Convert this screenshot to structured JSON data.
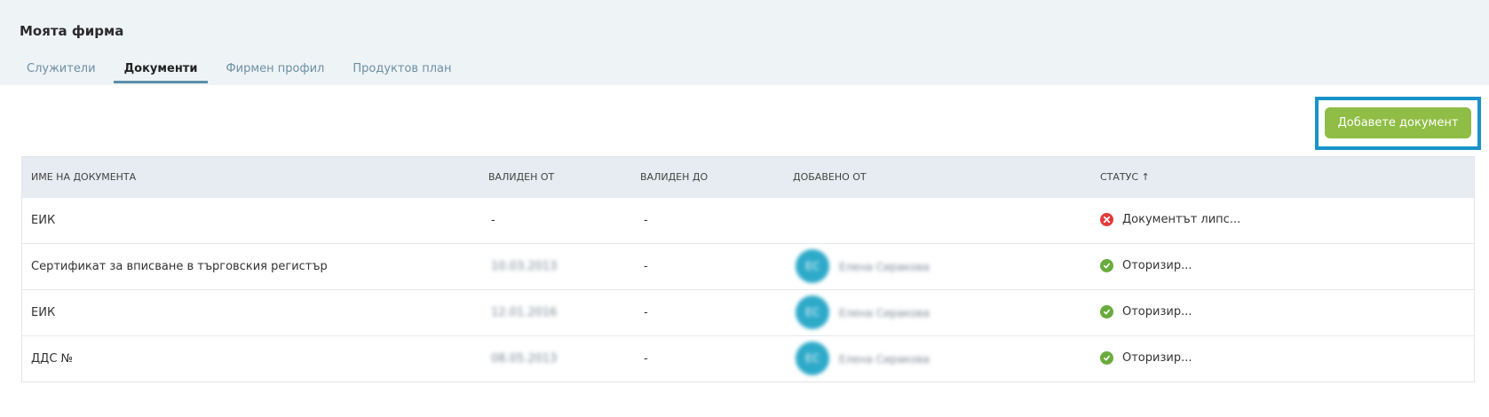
{
  "header": {
    "title": "Моята фирма",
    "tabs": [
      {
        "label": "Служители"
      },
      {
        "label": "Документи"
      },
      {
        "label": "Фирмен профил"
      },
      {
        "label": "Продуктов план"
      }
    ]
  },
  "actions": {
    "add_document_label": "Добавете документ"
  },
  "table": {
    "columns": {
      "name": "ИМЕ НА ДОКУМЕНТА",
      "valid_from": "ВАЛИДЕН ОТ",
      "valid_to": "ВАЛИДЕН ДО",
      "added_by": "ДОБАВЕНО ОТ",
      "status": "СТАТУС",
      "status_sort_icon": "↑"
    },
    "rows": [
      {
        "name": "ЕИК",
        "valid_from": "-",
        "valid_to": "-",
        "added_by_initials": "",
        "added_by": "",
        "status": "Документът липс...",
        "status_type": "missing"
      },
      {
        "name": "Сертификат за вписване в търговския регистър",
        "valid_from": "10.03.2013",
        "valid_to": "-",
        "added_by_initials": "ЕС",
        "added_by": "Елена Сиракова",
        "status": "Оторизир...",
        "status_type": "ok"
      },
      {
        "name": "ЕИК",
        "valid_from": "12.01.2016",
        "valid_to": "-",
        "added_by_initials": "ЕС",
        "added_by": "Елена Сиракова",
        "status": "Оторизир...",
        "status_type": "ok"
      },
      {
        "name": "ДДС №",
        "valid_from": "08.05.2013",
        "valid_to": "-",
        "added_by_initials": "ЕС",
        "added_by": "Елена Сиракова",
        "status": "Оторизир...",
        "status_type": "ok"
      }
    ]
  },
  "colors": {
    "accent": "#5b8fa9",
    "button": "#8fbd45",
    "highlight": "#1a93c9",
    "ok": "#6aab3d",
    "error": "#e23c3c"
  }
}
